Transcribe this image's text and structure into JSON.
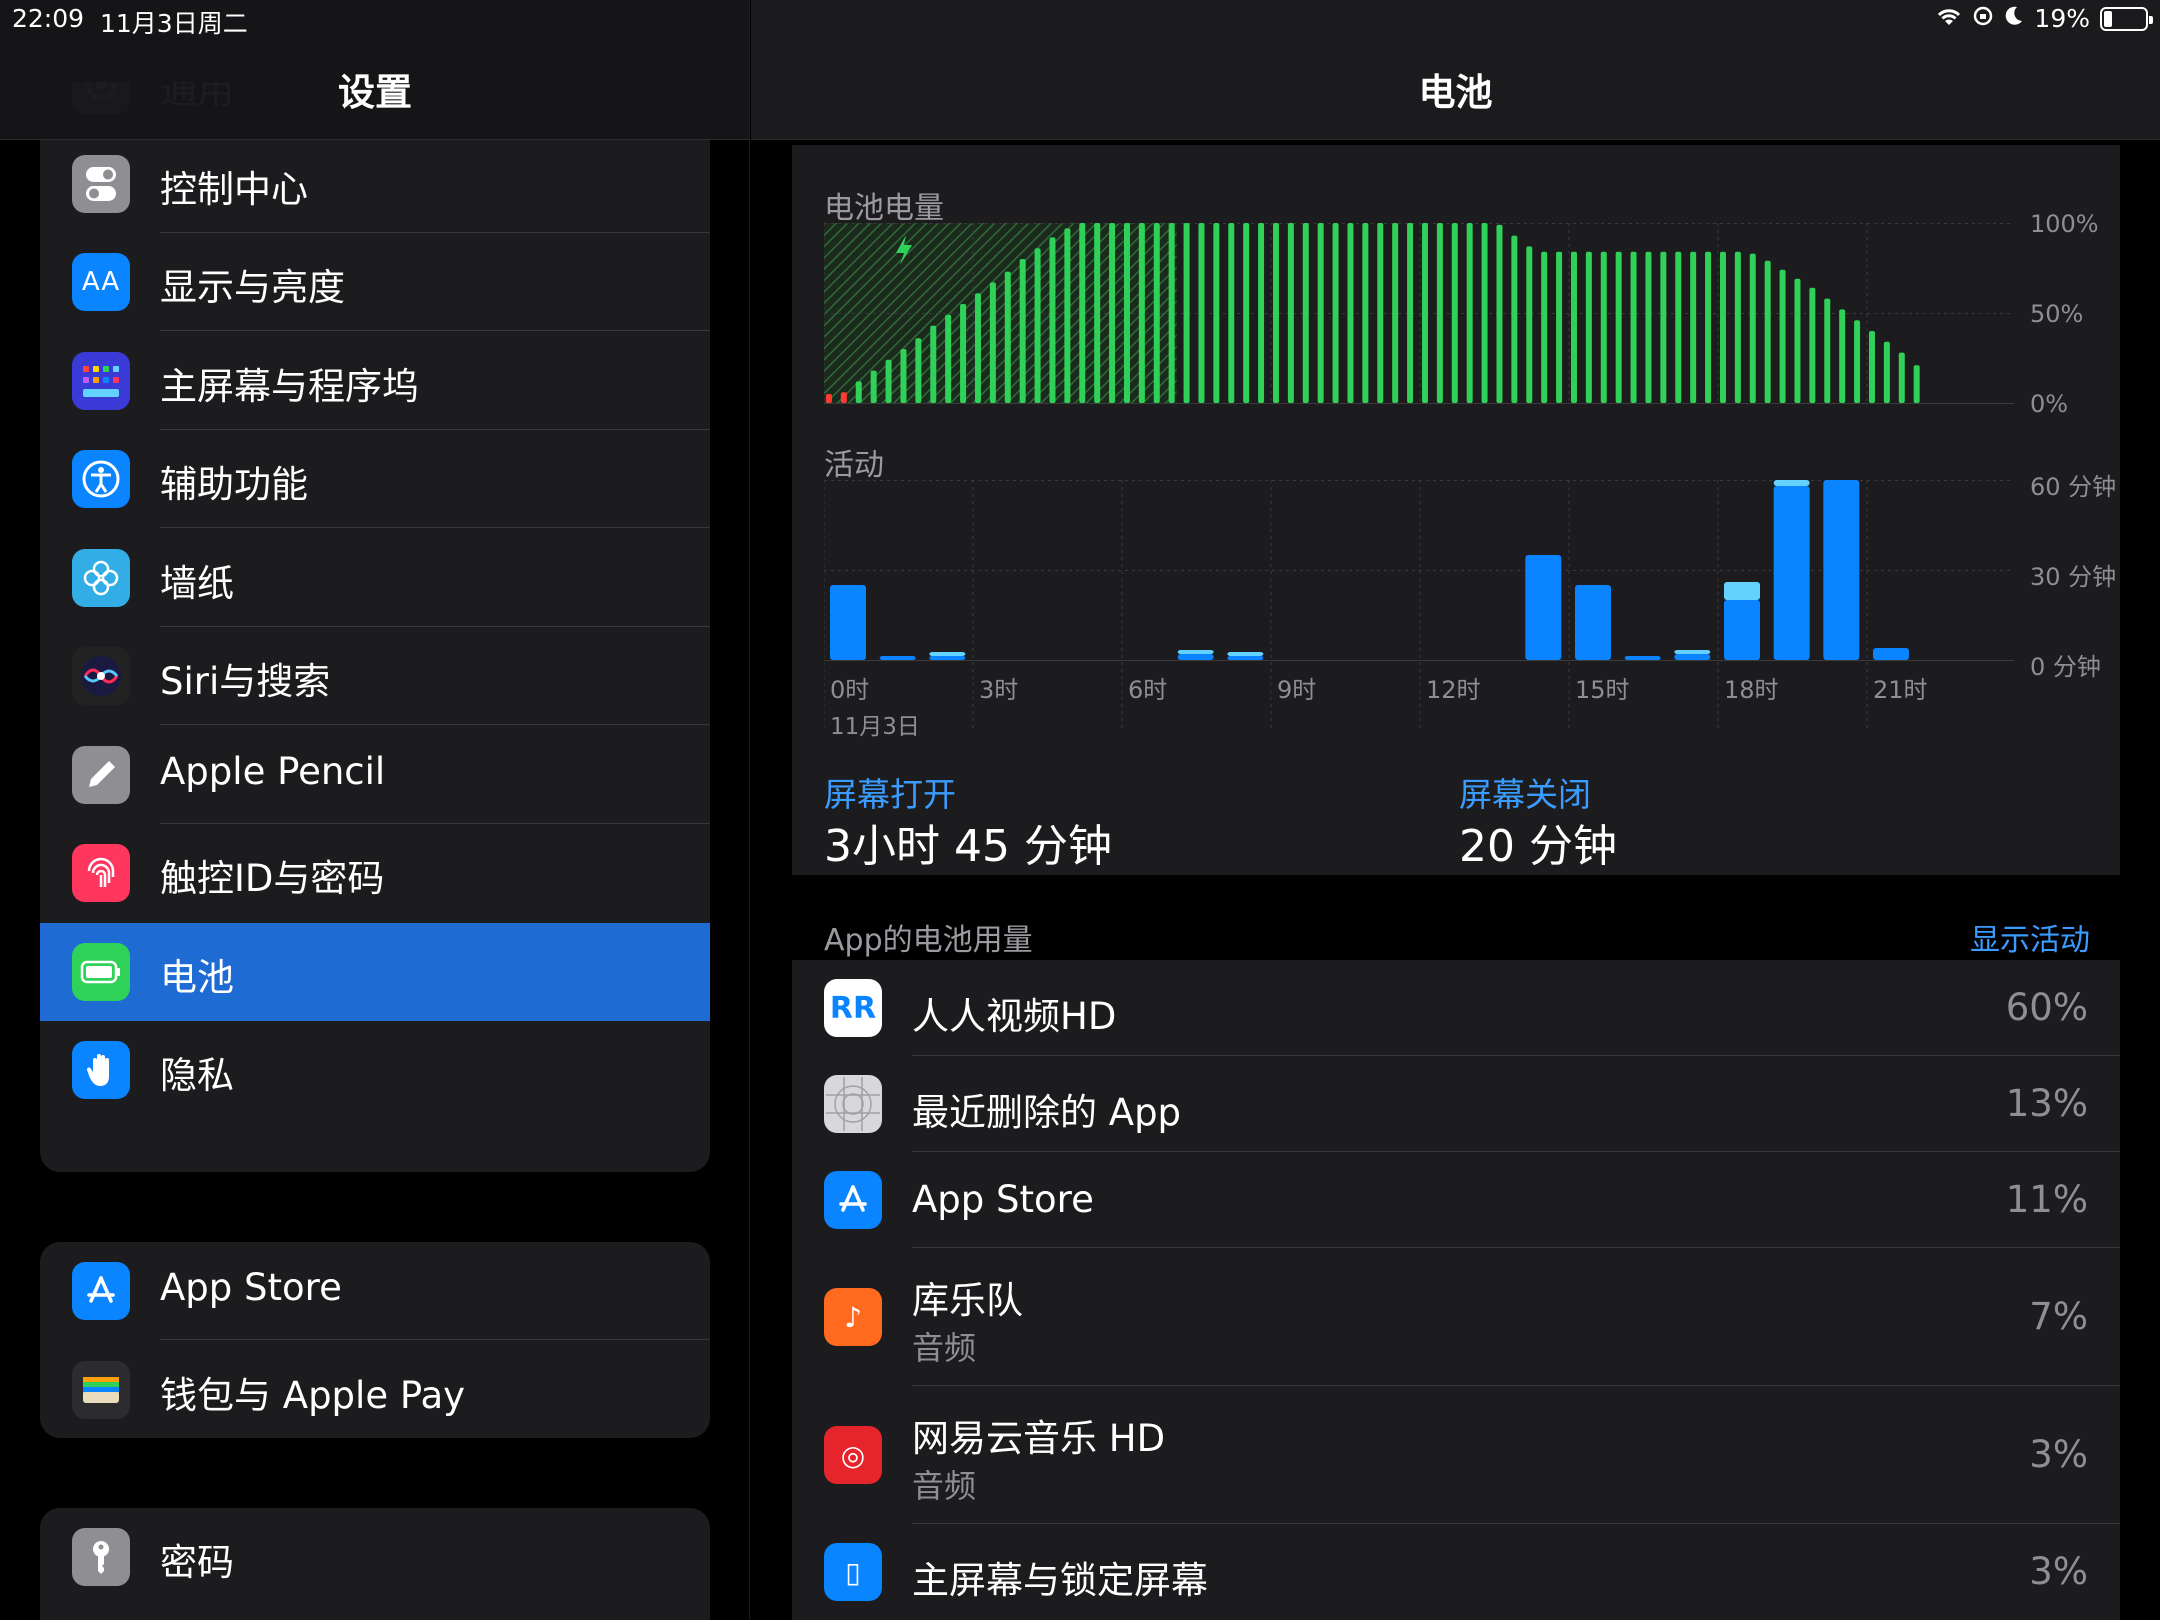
{
  "status": {
    "time": "22:09",
    "date": "11月3日周二",
    "battery": "19%",
    "battery_level": 0.19
  },
  "sidebar": {
    "title": "设置",
    "group1": [
      {
        "label": "通用",
        "icon": "gear-icon",
        "color": "#8e8e93"
      },
      {
        "label": "控制中心",
        "icon": "toggle-icon",
        "color": "#8e8e93"
      },
      {
        "label": "显示与亮度",
        "icon": "text-size-icon",
        "color": "#0a84ff",
        "glyph": "AA"
      },
      {
        "label": "主屏幕与程序坞",
        "icon": "home-grid-icon",
        "color": "#3a3ad6"
      },
      {
        "label": "辅助功能",
        "icon": "accessibility-icon",
        "color": "#0a84ff"
      },
      {
        "label": "墙纸",
        "icon": "flower-icon",
        "color": "#32ade6"
      },
      {
        "label": "Siri与搜索",
        "icon": "siri-icon",
        "color": "#222"
      },
      {
        "label": "Apple Pencil",
        "icon": "pencil-icon",
        "color": "#8e8e93"
      },
      {
        "label": "触控ID与密码",
        "icon": "fingerprint-icon",
        "color": "#ff375f"
      },
      {
        "label": "电池",
        "icon": "battery-icon",
        "color": "#30d158",
        "selected": true
      },
      {
        "label": "隐私",
        "icon": "hand-icon",
        "color": "#0a84ff"
      }
    ],
    "group2": [
      {
        "label": "App Store",
        "icon": "app-store-icon",
        "color": "#0a84ff"
      },
      {
        "label": "钱包与 Apple Pay",
        "icon": "wallet-icon",
        "color": "#2c2c2e"
      }
    ],
    "group3": [
      {
        "label": "密码",
        "icon": "key-icon",
        "color": "#8e8e93"
      }
    ]
  },
  "main": {
    "title": "电池",
    "level_label": "电池电量",
    "activity_label": "活动",
    "level_axis": [
      "100%",
      "50%",
      "0%"
    ],
    "activity_axis": [
      "60 分钟",
      "30 分钟",
      "0 分钟"
    ],
    "time_axis": [
      "0时",
      "3时",
      "6时",
      "9时",
      "12时",
      "15时",
      "18时",
      "21时"
    ],
    "date_label": "11月3日",
    "screen_on_label": "屏幕打开",
    "screen_on_value": "3小时 45 分钟",
    "screen_off_label": "屏幕关闭",
    "screen_off_value": "20 分钟",
    "apps_label": "App的电池用量",
    "show_activity": "显示活动",
    "apps": [
      {
        "name": "人人视频HD",
        "sub": "",
        "pct": "60%",
        "icon": "rr-video-icon",
        "color": "#ffffff",
        "glyph": "RR"
      },
      {
        "name": "最近删除的 App",
        "sub": "",
        "pct": "13%",
        "icon": "deleted-app-icon",
        "color": "#d8d8dc",
        "glyph": ""
      },
      {
        "name": "App Store",
        "sub": "",
        "pct": "11%",
        "icon": "app-store-icon",
        "color": "#0a84ff",
        "glyph": "A"
      },
      {
        "name": "库乐队",
        "sub": "音频",
        "pct": "7%",
        "icon": "garageband-icon",
        "color": "#ff6a1f",
        "glyph": "♪"
      },
      {
        "name": "网易云音乐 HD",
        "sub": "音频",
        "pct": "3%",
        "icon": "netease-music-icon",
        "color": "#e5242b",
        "glyph": "◎"
      },
      {
        "name": "主屏幕与锁定屏幕",
        "sub": "",
        "pct": "3%",
        "icon": "home-lock-icon",
        "color": "#0a84ff",
        "glyph": "▯"
      }
    ]
  },
  "chart_data": [
    {
      "type": "bar",
      "title": "电池电量",
      "x_range": [
        0,
        24
      ],
      "ylim": [
        0,
        100
      ],
      "charging_until": 7.1,
      "colors": {
        "charging": "#30d158",
        "normal": "#30d158",
        "low": "#ff3b30"
      },
      "x": [
        0.1,
        0.4,
        0.7,
        1.0,
        1.3,
        1.6,
        1.9,
        2.2,
        2.5,
        2.8,
        3.1,
        3.4,
        3.7,
        4.0,
        4.3,
        4.6,
        4.9,
        5.2,
        5.5,
        5.8,
        6.1,
        6.4,
        6.7,
        7.0,
        7.3,
        7.6,
        7.9,
        8.2,
        8.5,
        8.8,
        9.1,
        9.4,
        9.7,
        10.0,
        10.3,
        10.6,
        10.9,
        11.2,
        11.5,
        11.8,
        12.1,
        12.4,
        12.7,
        13.0,
        13.3,
        13.6,
        13.9,
        14.2,
        14.5,
        14.8,
        15.1,
        15.4,
        15.7,
        16.0,
        16.3,
        16.6,
        16.9,
        17.2,
        17.5,
        17.8,
        18.1,
        18.4,
        18.7,
        19.0,
        19.3,
        19.6,
        19.9,
        20.2,
        20.5,
        20.8,
        21.1,
        21.4,
        21.7,
        22.0
      ],
      "values": [
        5,
        6,
        12,
        18,
        24,
        30,
        36,
        43,
        49,
        55,
        61,
        67,
        73,
        80,
        86,
        92,
        97,
        100,
        100,
        100,
        100,
        100,
        100,
        100,
        100,
        100,
        100,
        100,
        100,
        100,
        100,
        100,
        100,
        100,
        100,
        100,
        100,
        100,
        100,
        100,
        100,
        100,
        100,
        100,
        100,
        99,
        93,
        87,
        84,
        84,
        84,
        84,
        84,
        84,
        84,
        84,
        84,
        84,
        84,
        84,
        84,
        84,
        83,
        79,
        74,
        69,
        64,
        58,
        52,
        46,
        40,
        34,
        28,
        21
      ]
    },
    {
      "type": "bar",
      "title": "活动",
      "categories": [
        "0时",
        "1时",
        "2时",
        "3时",
        "4时",
        "5时",
        "6时",
        "7时",
        "8时",
        "9时",
        "10时",
        "11时",
        "12时",
        "13时",
        "14时",
        "15时",
        "16时",
        "17时",
        "18时",
        "19时",
        "20时",
        "21时",
        "22时",
        "23时"
      ],
      "series": [
        {
          "name": "屏幕打开",
          "color": "#0a84ff",
          "values": [
            25,
            1,
            1,
            0,
            0,
            0,
            0,
            2,
            1,
            0,
            0,
            0,
            0,
            0,
            35,
            25,
            1,
            2,
            20,
            58,
            60,
            4,
            0,
            0
          ]
        },
        {
          "name": "屏幕关闭",
          "color": "#64d2ff",
          "values": [
            0,
            0,
            1,
            0,
            0,
            0,
            0,
            1,
            1,
            0,
            0,
            0,
            0,
            0,
            0,
            0,
            0,
            1,
            6,
            2,
            0,
            0,
            0,
            0
          ]
        }
      ],
      "ylim": [
        0,
        60
      ]
    }
  ]
}
